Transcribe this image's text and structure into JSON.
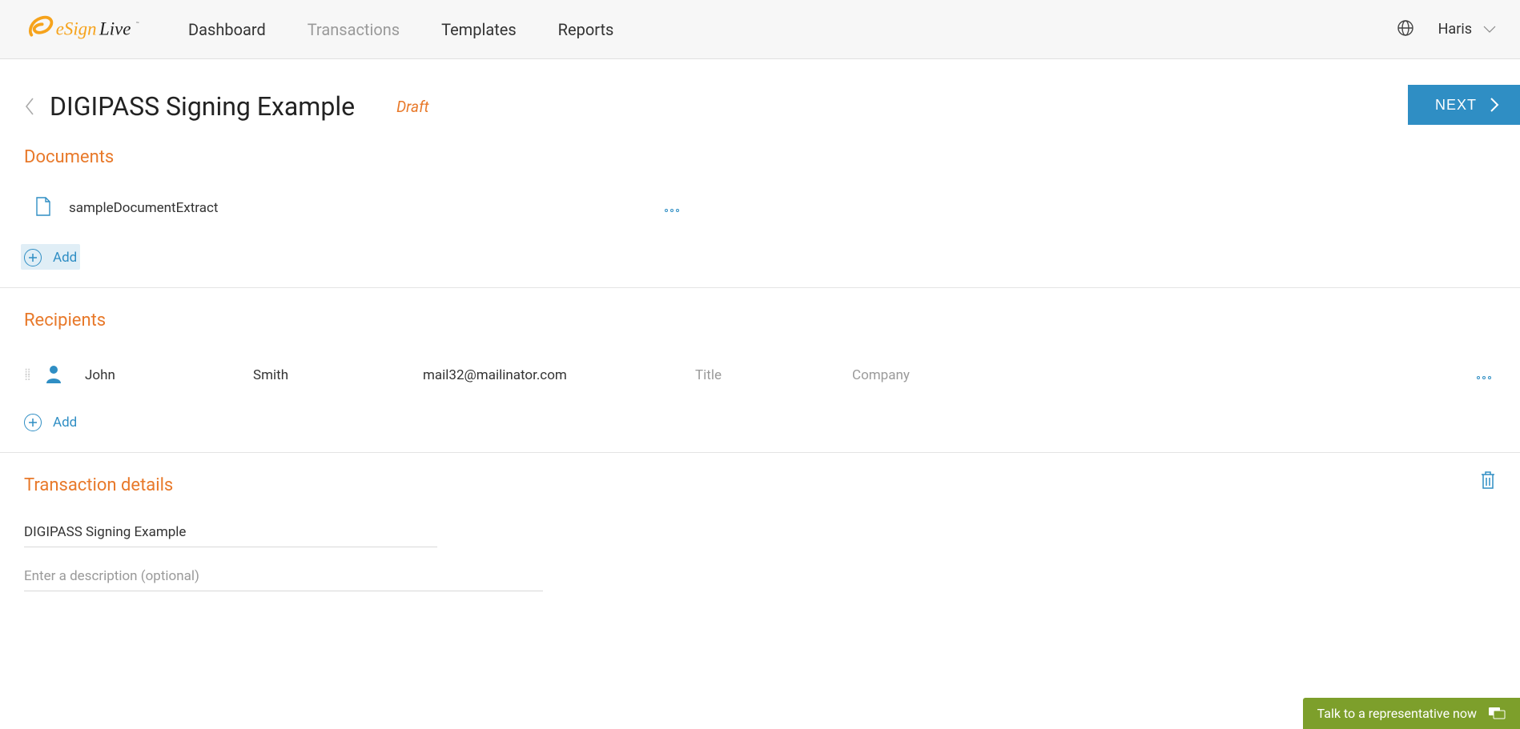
{
  "logo": {
    "brand_a": "eSign",
    "brand_b": "Live"
  },
  "nav": {
    "dashboard": "Dashboard",
    "transactions": "Transactions",
    "templates": "Templates",
    "reports": "Reports"
  },
  "user": {
    "name": "Haris"
  },
  "page": {
    "title": "DIGIPASS Signing Example",
    "status": "Draft",
    "next_label": "NEXT"
  },
  "documents": {
    "heading": "Documents",
    "items": [
      {
        "name": "sampleDocumentExtract"
      }
    ],
    "add_label": "Add"
  },
  "recipients": {
    "heading": "Recipients",
    "items": [
      {
        "first_name": "John",
        "last_name": "Smith",
        "email": "mail32@mailinator.com",
        "title_placeholder": "Title",
        "company_placeholder": "Company"
      }
    ],
    "add_label": "Add"
  },
  "details": {
    "heading": "Transaction details",
    "name_value": "DIGIPASS Signing Example",
    "description_placeholder": "Enter a description (optional)"
  },
  "chat": {
    "label": "Talk to a representative now"
  }
}
